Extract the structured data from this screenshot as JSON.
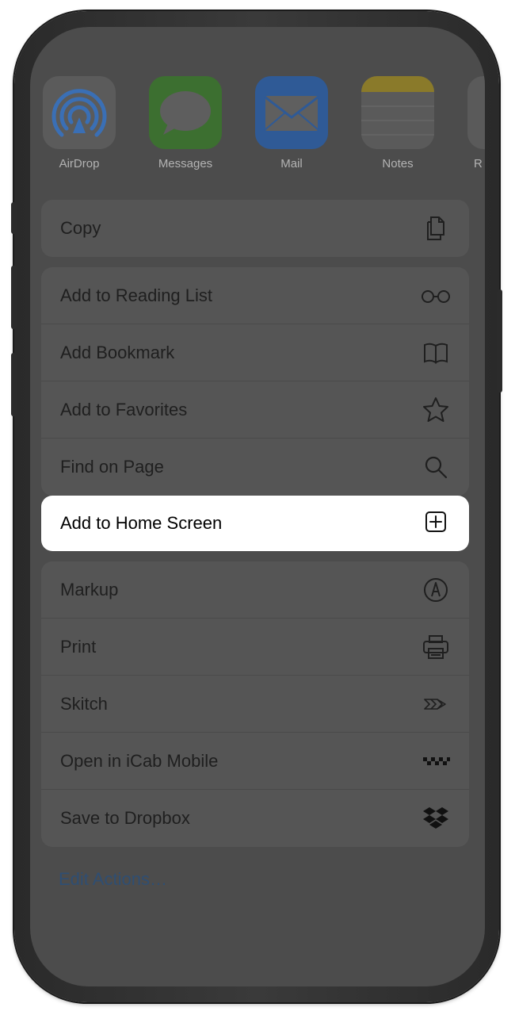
{
  "share_apps": [
    {
      "label": "AirDrop",
      "icon": "airdrop-icon"
    },
    {
      "label": "Messages",
      "icon": "messages-icon"
    },
    {
      "label": "Mail",
      "icon": "mail-icon"
    },
    {
      "label": "Notes",
      "icon": "notes-icon"
    },
    {
      "label": "R",
      "icon": "app-icon"
    }
  ],
  "group1": [
    {
      "label": "Copy",
      "icon": "copy-icon"
    }
  ],
  "group2": [
    {
      "label": "Add to Reading List",
      "icon": "glasses-icon"
    },
    {
      "label": "Add Bookmark",
      "icon": "book-icon"
    },
    {
      "label": "Add to Favorites",
      "icon": "star-icon"
    },
    {
      "label": "Find on Page",
      "icon": "search-icon"
    }
  ],
  "highlighted": {
    "label": "Add to Home Screen",
    "icon": "add-square-icon"
  },
  "group3": [
    {
      "label": "Markup",
      "icon": "markup-icon"
    },
    {
      "label": "Print",
      "icon": "printer-icon"
    },
    {
      "label": "Skitch",
      "icon": "skitch-icon"
    },
    {
      "label": "Open in iCab Mobile",
      "icon": "icab-icon"
    },
    {
      "label": "Save to Dropbox",
      "icon": "dropbox-icon"
    }
  ],
  "edit_actions": "Edit Actions…",
  "colors": {
    "dim_overlay": "#4c4c4c",
    "highlight_bg": "#ffffff",
    "link_blue": "#2f4e72"
  }
}
